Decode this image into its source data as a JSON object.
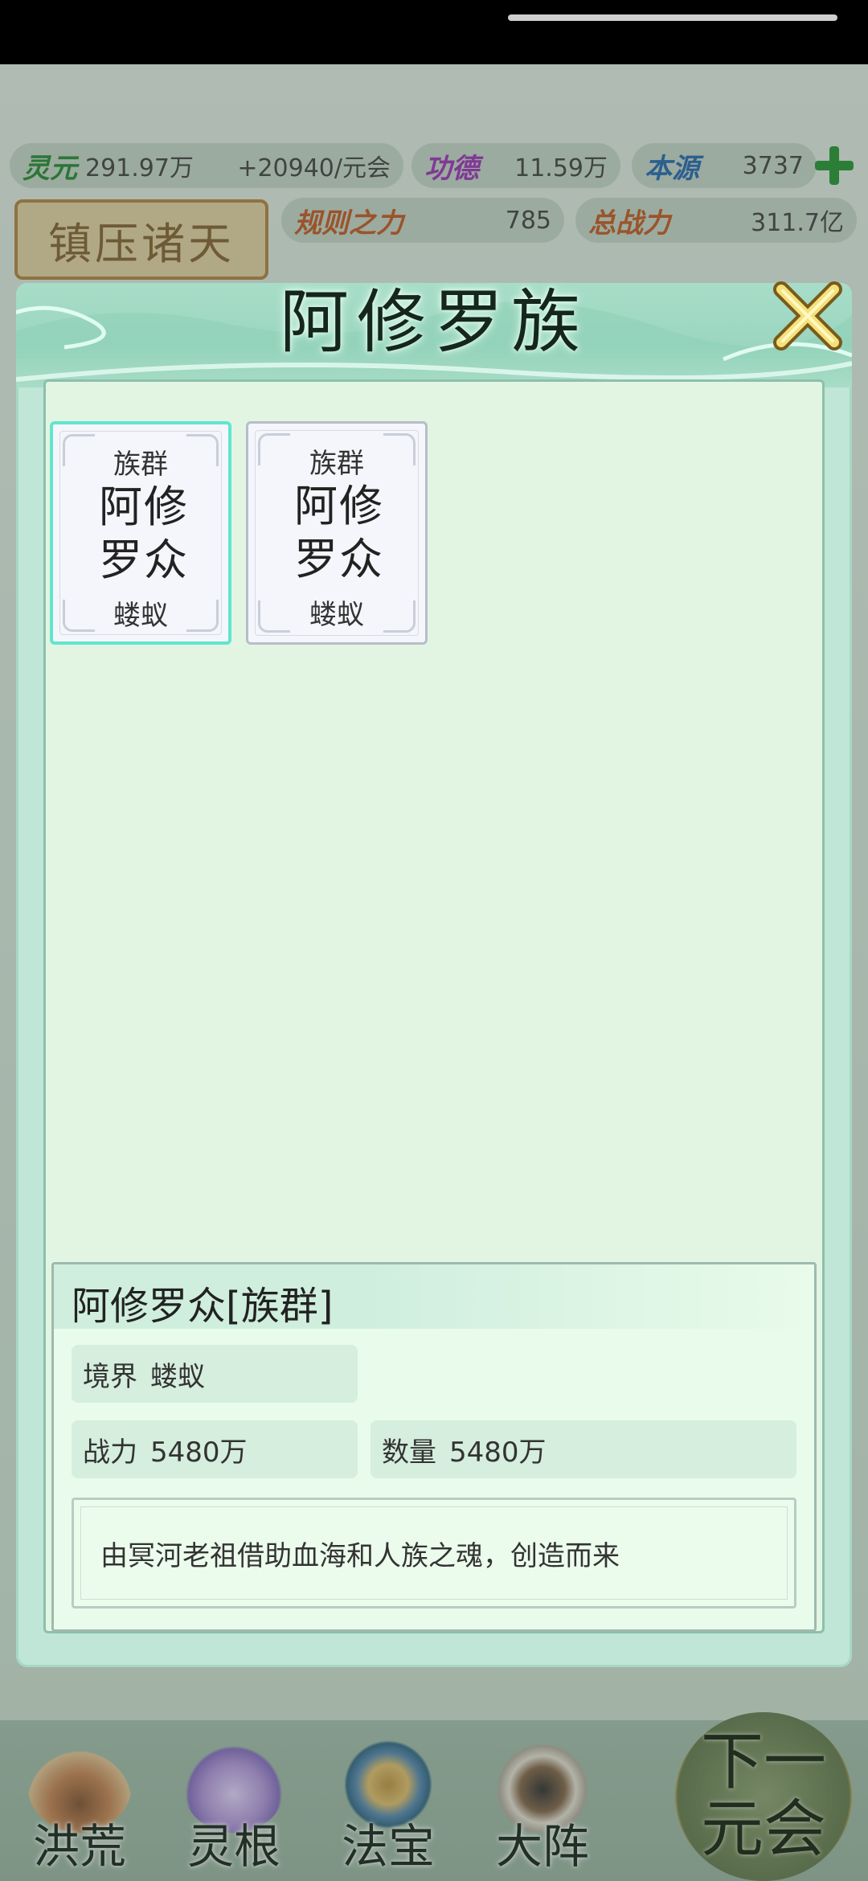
{
  "resources": {
    "lingyuan": {
      "label": "灵元",
      "value": "291.97万",
      "rate": "+20940/元会"
    },
    "gongde": {
      "label": "功德",
      "value": "11.59万"
    },
    "benyuan": {
      "label": "本源",
      "value": "3737"
    },
    "guize": {
      "label": "规则之力",
      "value": "785"
    },
    "zhanli": {
      "label": "总战力",
      "value": "311.7亿"
    }
  },
  "banner": {
    "label": "镇压诸天"
  },
  "dialog": {
    "title": "阿修罗族",
    "cards": [
      {
        "type": "族群",
        "name": "阿修罗众",
        "realm": "蝼蚁"
      },
      {
        "type": "族群",
        "name": "阿修罗众",
        "realm": "蝼蚁"
      }
    ],
    "detail": {
      "title": "阿修罗众[族群]",
      "realm_label": "境界",
      "realm_value": "蝼蚁",
      "power_label": "战力",
      "power_value": "5480万",
      "count_label": "数量",
      "count_value": "5480万",
      "description": "由冥河老祖借助血海和人族之魂，创造而来"
    }
  },
  "nav": {
    "items": [
      {
        "label": "洪荒",
        "icon": "mountain-icon"
      },
      {
        "label": "灵根",
        "icon": "lotus-icon"
      },
      {
        "label": "法宝",
        "icon": "treasure-icon"
      },
      {
        "label": "大阵",
        "icon": "formation-icon"
      }
    ],
    "next": {
      "label": "下一元会"
    }
  },
  "colors": {
    "accent": "#62e5cf",
    "dialog_bg": "#bfe6d6",
    "panel_bg": "#e2f5e3"
  }
}
